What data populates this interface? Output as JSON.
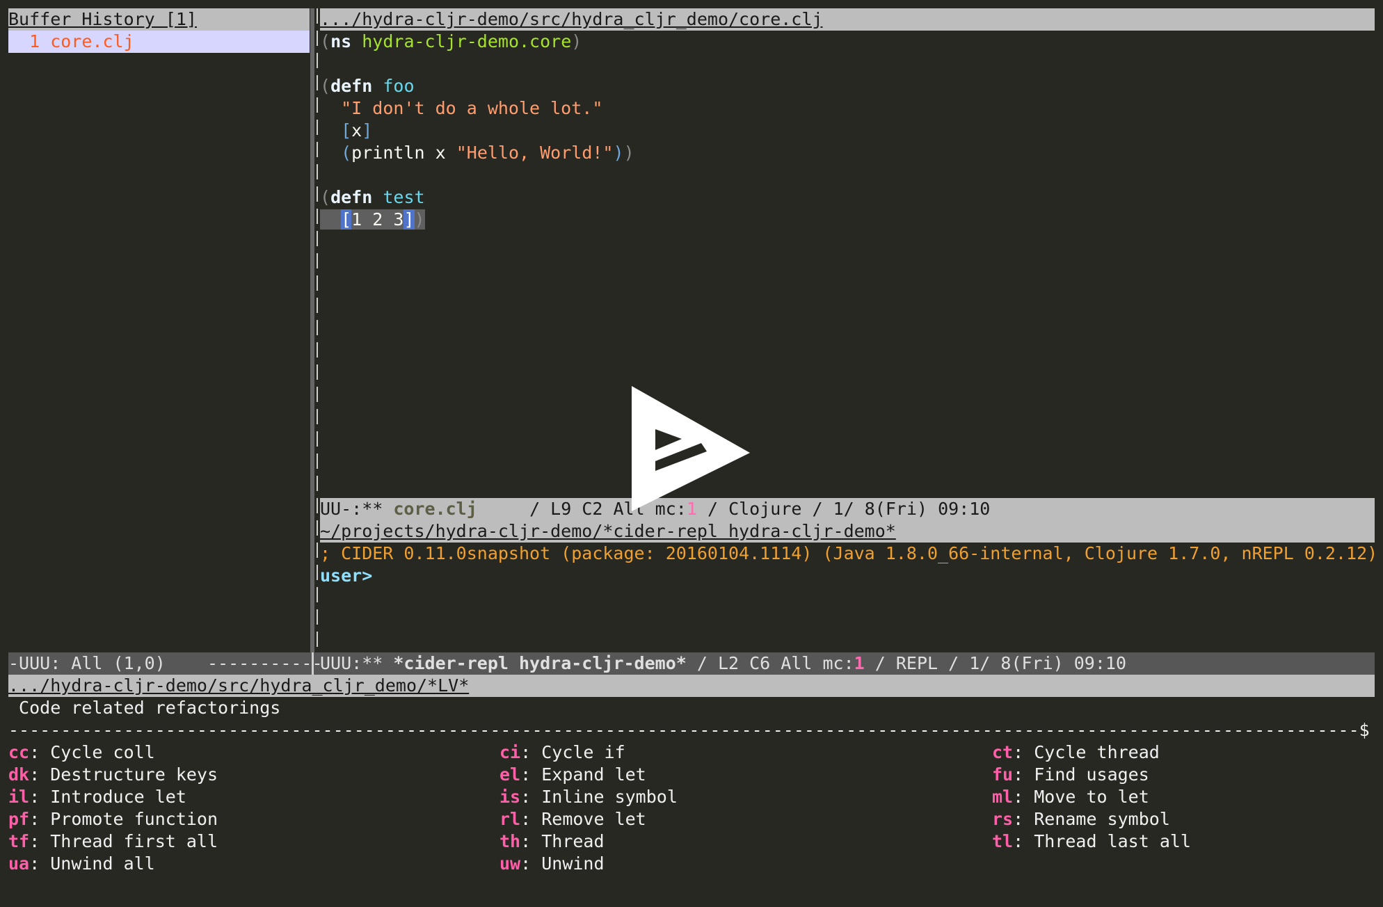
{
  "left_pane": {
    "header": "Buffer History [1]",
    "items": [
      {
        "index": "1",
        "name": "core.clj"
      }
    ]
  },
  "editor": {
    "header": ".../hydra-cljr-demo/src/hydra_cljr_demo/core.clj",
    "code": {
      "ns_kw": "ns",
      "ns_name": "hydra-cljr-demo.core",
      "defn_kw": "defn",
      "foo_name": "foo",
      "foo_doc": "\"I don't do a whole lot.\"",
      "foo_args": "x",
      "println": "println",
      "println_arg": "x",
      "hello_str": "\"Hello, World!\"",
      "test_name": "test",
      "vec_values": "1 2 3"
    },
    "modeline": {
      "state": "UU-:**",
      "buffer": "core.clj",
      "position": "/ L9 C2 All mc:",
      "mc_count": "1",
      "rest": "/ Clojure / 1/ 8(Fri) 09:10"
    }
  },
  "repl": {
    "header": "~/projects/hydra-cljr-demo/*cider-repl hydra-cljr-demo*",
    "banner": "; CIDER 0.11.0snapshot (package: 20160104.1114) (Java 1.8.0_66-internal, Clojure 1.7.0, nREPL 0.2.12)",
    "prompt": "user>"
  },
  "bottom_modeline": {
    "left": "-UUU: All (1,0)    -----------",
    "state": "UUU:**",
    "buffer": "*cider-repl hydra-cljr-demo*",
    "position": "/ L2 C6 All mc:",
    "mc_count": "1",
    "rest": "/ REPL / 1/ 8(Fri) 09:10"
  },
  "lv": {
    "header": ".../hydra-cljr-demo/src/hydra_cljr_demo/*LV*",
    "title": " Code related refactorings",
    "end_mark": "$"
  },
  "hydra": {
    "columns": [
      [
        {
          "key": "cc",
          "label": "Cycle coll"
        },
        {
          "key": "dk",
          "label": "Destructure keys"
        },
        {
          "key": "il",
          "label": "Introduce let"
        },
        {
          "key": "pf",
          "label": "Promote function"
        },
        {
          "key": "tf",
          "label": "Thread first all"
        },
        {
          "key": "ua",
          "label": "Unwind all"
        }
      ],
      [
        {
          "key": "ci",
          "label": "Cycle if"
        },
        {
          "key": "el",
          "label": "Expand let"
        },
        {
          "key": "is",
          "label": "Inline symbol"
        },
        {
          "key": "rl",
          "label": "Remove let"
        },
        {
          "key": "th",
          "label": "Thread"
        },
        {
          "key": "uw",
          "label": "Unwind"
        }
      ],
      [
        {
          "key": "ct",
          "label": "Cycle thread"
        },
        {
          "key": "fu",
          "label": "Find usages"
        },
        {
          "key": "ml",
          "label": "Move to let"
        },
        {
          "key": "rs",
          "label": "Rename symbol"
        },
        {
          "key": "tl",
          "label": "Thread last all"
        }
      ]
    ]
  },
  "overlay": {
    "icon": "play-icon"
  }
}
